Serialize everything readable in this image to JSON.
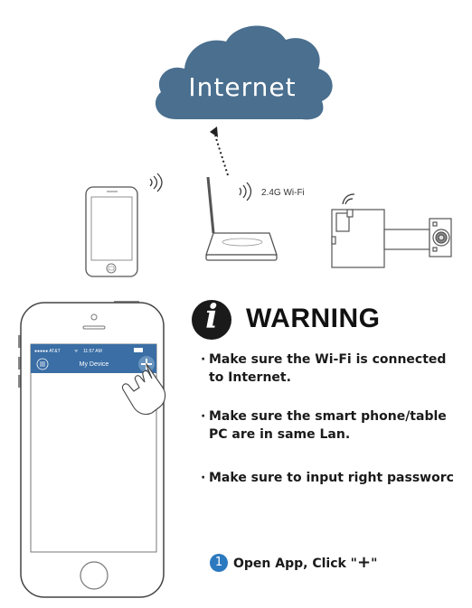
{
  "diagram": {
    "cloud_label": "Internet",
    "wifi_label": "2.4G Wi-Fi"
  },
  "phone_app": {
    "status_carrier": "●●●●● AT&T",
    "status_time": "11:57 AM",
    "header_title": "My Device",
    "menu_icon": "menu-icon",
    "add_icon": "plus-icon"
  },
  "warning": {
    "title": "WARNING",
    "bullets": [
      {
        "line1": "Make sure the Wi-Fi is connected",
        "line2": "to Internet."
      },
      {
        "line1": "Make sure the smart phone/table",
        "line2": "PC are in same Lan."
      },
      {
        "line1": "Make sure to input right passworc",
        "line2": ""
      }
    ]
  },
  "step": {
    "number": "1",
    "text_prefix": "Open App, Click \"",
    "symbol": "+",
    "text_suffix": "\""
  },
  "colors": {
    "cloud": "#4a6f8f",
    "app_header": "#3a6ea5",
    "step_badge": "#2b79bf"
  }
}
